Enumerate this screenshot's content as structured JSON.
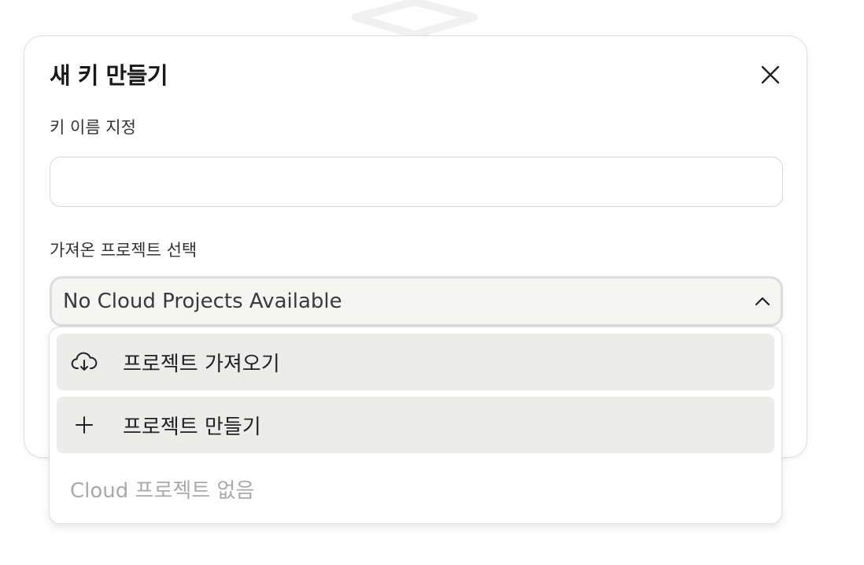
{
  "dialog": {
    "title": "새 키 만들기",
    "close_icon": "close-icon"
  },
  "form": {
    "name_label": "키 이름 지정",
    "name_value": "",
    "name_placeholder": "",
    "project_label": "가져온 프로젝트 선택",
    "project_selected": "No Cloud Projects Available",
    "project_chevron_icon": "chevron-up-icon"
  },
  "dropdown": {
    "items": [
      {
        "icon": "cloud-download-icon",
        "label": "프로젝트 가져오기"
      },
      {
        "icon": "plus-icon",
        "label": "프로젝트 만들기"
      }
    ],
    "empty_text": "Cloud 프로젝트 없음"
  },
  "colors": {
    "dialog_border": "#dedede",
    "item_highlight": "#ececeb",
    "select_background": "#f5f5f4",
    "muted_text": "#a9a9a9"
  }
}
